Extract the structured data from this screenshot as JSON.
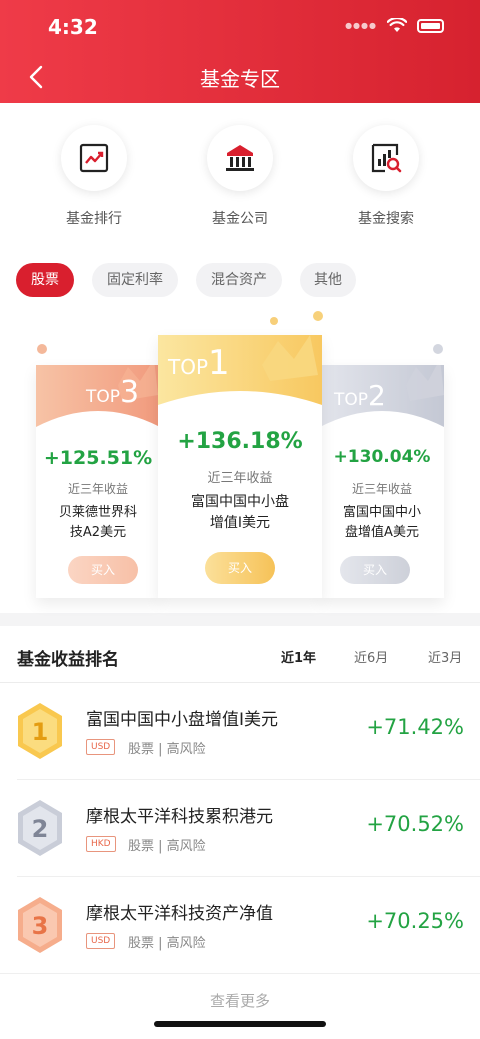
{
  "status_bar": {
    "time": "4:32"
  },
  "header": {
    "title": "基金专区"
  },
  "entries": [
    {
      "label": "基金排行",
      "icon": "chart-trend-icon"
    },
    {
      "label": "基金公司",
      "icon": "bank-building-icon"
    },
    {
      "label": "基金搜索",
      "icon": "search-chart-icon"
    }
  ],
  "category_tabs": [
    "股票",
    "固定利率",
    "混合资产",
    "其他"
  ],
  "active_category": "股票",
  "podium": {
    "top1": {
      "badge_prefix": "TOP",
      "badge_num": "1",
      "pct": "+136.18%",
      "sub": "近三年收益",
      "name_line1": "富国中国中小盘",
      "name_line2": "增值I美元",
      "buy": "买入"
    },
    "top2": {
      "badge_prefix": "TOP",
      "badge_num": "2",
      "pct": "+130.04%",
      "sub": "近三年收益",
      "name_line1": "富国中国中小",
      "name_line2": "盘增值A美元",
      "buy": "买入"
    },
    "top3": {
      "badge_prefix": "TOP",
      "badge_num": "3",
      "pct": "+125.51%",
      "sub": "近三年收益",
      "name_line1": "贝莱德世界科",
      "name_line2": "技A2美元",
      "buy": "买入"
    }
  },
  "ranking": {
    "title": "基金收益排名",
    "periods": [
      "近1年",
      "近6月",
      "近3月"
    ],
    "active_period": "近1年",
    "rows": [
      {
        "rank": "1",
        "name": "富国中国中小盘增值I美元",
        "currency": "USD",
        "tags": "股票 | 高风险",
        "pct": "+71.42%"
      },
      {
        "rank": "2",
        "name": "摩根太平洋科技累积港元",
        "currency": "HKD",
        "tags": "股票 | 高风险",
        "pct": "+70.52%"
      },
      {
        "rank": "3",
        "name": "摩根太平洋科技资产净值",
        "currency": "USD",
        "tags": "股票 | 高风险",
        "pct": "+70.25%"
      }
    ],
    "more": "查看更多"
  },
  "colors": {
    "brand_red": "#d91f2e",
    "gain_green": "#23a343",
    "gold": "#f7c15a",
    "silver": "#c7cad6",
    "bronze": "#f4a98a"
  }
}
